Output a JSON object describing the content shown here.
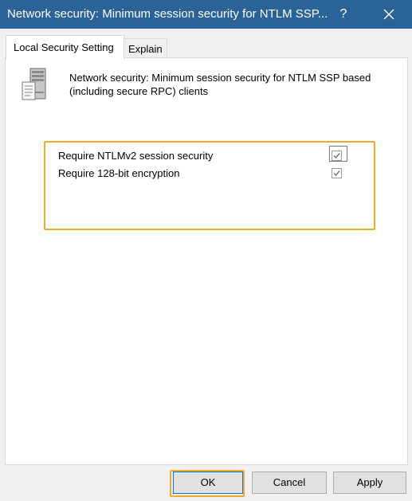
{
  "window": {
    "title": "Network security: Minimum session security for NTLM SSP...",
    "help_label": "?"
  },
  "tabs": [
    {
      "label": "Local Security Setting",
      "selected": true
    },
    {
      "label": "Explain",
      "selected": false
    }
  ],
  "setting": {
    "icon": "server-icon",
    "description": "Network security: Minimum session security for NTLM SSP based (including secure RPC) clients"
  },
  "options": [
    {
      "label": "Require NTLMv2 session security",
      "checked": true,
      "focused": true
    },
    {
      "label": "Require 128-bit encryption",
      "checked": true,
      "focused": false
    }
  ],
  "buttons": {
    "ok": "OK",
    "cancel": "Cancel",
    "apply": "Apply"
  },
  "colors": {
    "titlebar": "#2b6297",
    "highlight": "#f0a92b",
    "checkmark": "#555555"
  }
}
